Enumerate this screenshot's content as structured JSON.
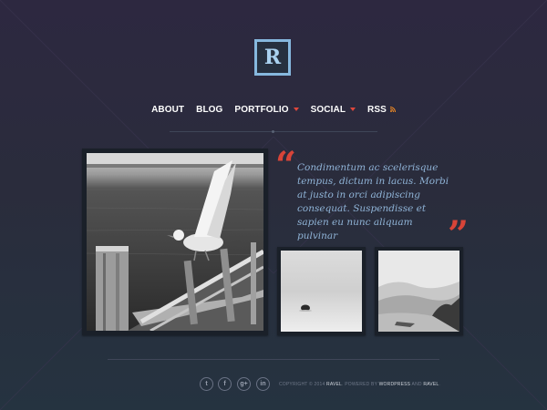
{
  "logo": {
    "letter": "R"
  },
  "nav": {
    "items": [
      {
        "label": "ABOUT"
      },
      {
        "label": "BLOG"
      },
      {
        "label": "PORTFOLIO"
      },
      {
        "label": "SOCIAL"
      },
      {
        "label": "RSS"
      }
    ]
  },
  "quote": {
    "open_mark": "“",
    "close_mark": "”",
    "text": "Condimentum ac scelerisque tempus, dictum in lacus. Morbi at justo in orci adipiscing consequat. Suspendisse et sapien eu nunc aliquam pulvinar"
  },
  "social": {
    "twitter": "t",
    "facebook": "f",
    "googleplus": "g+",
    "linkedin": "in"
  },
  "footer": {
    "copyright": "COPYRIGHT © 2014",
    "brand": "RAVEL",
    "powered": ". POWERED BY",
    "wordpress": "WORDPRESS",
    "and": "AND",
    "ravel2": "RAVEL",
    "end": "."
  },
  "colors": {
    "accent": "#d84438",
    "logo_border": "#86b8de",
    "quote_text": "#8fb3d6",
    "rss": "#f08a24"
  }
}
